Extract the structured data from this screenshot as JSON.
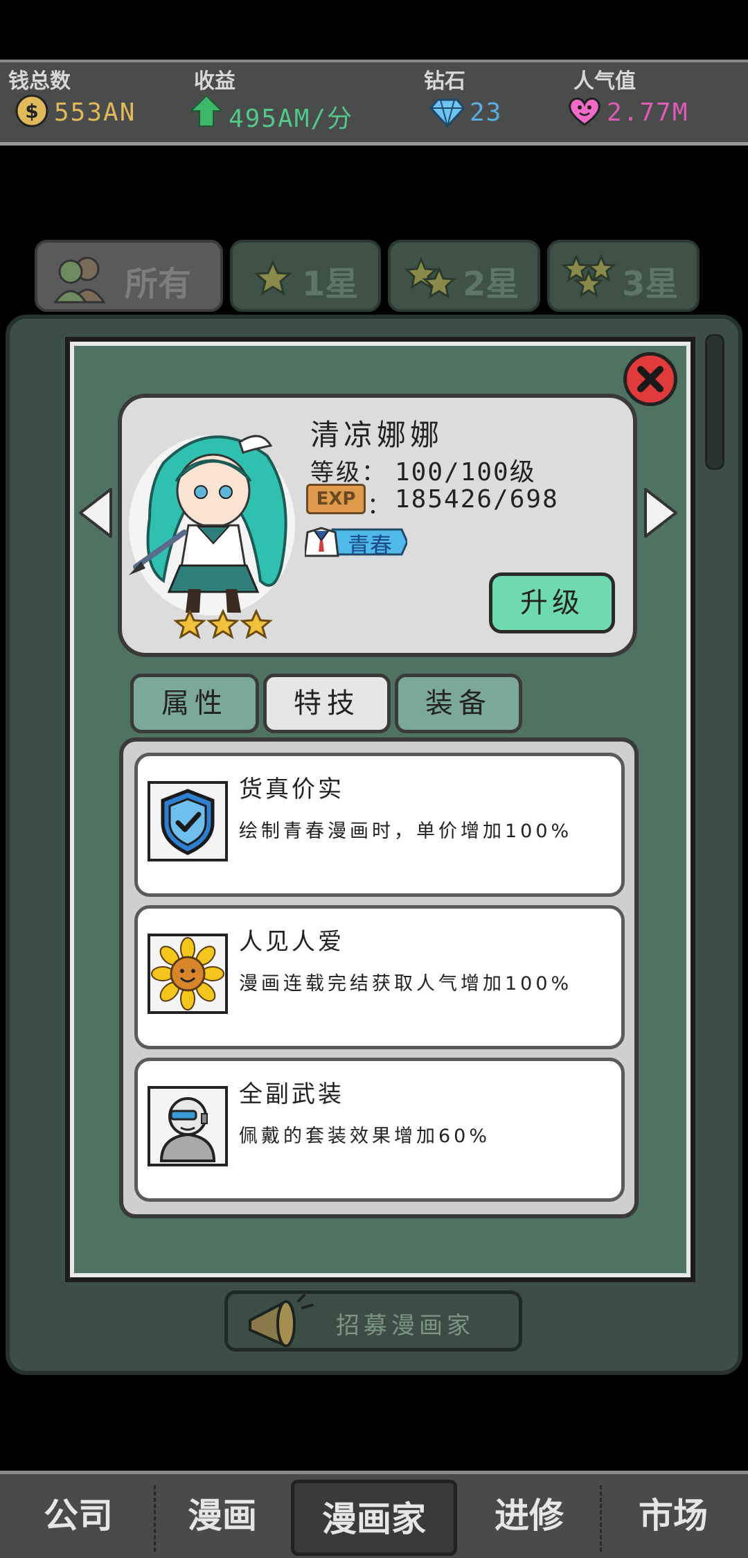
{
  "stats": [
    {
      "label": "钱总数",
      "value": "553AN",
      "icon": "coin-icon",
      "color": "#e0b95a"
    },
    {
      "label": "收益",
      "value": "495AM/分",
      "icon": "arrow-up-icon",
      "color": "#52c88a"
    },
    {
      "label": "钻石",
      "value": "23",
      "icon": "diamond-icon",
      "color": "#5aaee0"
    },
    {
      "label": "人气值",
      "value": "2.77M",
      "icon": "heart-icon",
      "color": "#e05ab8"
    }
  ],
  "filter_tabs": [
    {
      "label": "所有",
      "active": true
    },
    {
      "label": "1星"
    },
    {
      "label": "2星"
    },
    {
      "label": "3星"
    }
  ],
  "character": {
    "name": "清凉娜娜",
    "level_label": "等级：",
    "level_value": "100/100级",
    "exp_badge": "EXP",
    "exp_colon": "：",
    "exp_value": "185426/698",
    "genre": "青春",
    "stars": 3,
    "upgrade_label": "升级"
  },
  "sub_tabs": [
    {
      "label": "属性"
    },
    {
      "label": "特技",
      "active": true
    },
    {
      "label": "装备"
    }
  ],
  "skills": [
    {
      "name": "货真价实",
      "desc": "绘制青春漫画时，单价增加100%",
      "icon": "shield-check-icon"
    },
    {
      "name": "人见人爱",
      "desc": "漫画连载完结获取人气增加100%",
      "icon": "sunflower-icon"
    },
    {
      "name": "全副武装",
      "desc": "佩戴的套装效果增加60%",
      "icon": "armor-helmet-icon"
    }
  ],
  "recruit_label": "招募漫画家",
  "bottom_nav": [
    {
      "label": "公司"
    },
    {
      "label": "漫画"
    },
    {
      "label": "漫画家",
      "active": true
    },
    {
      "label": "进修"
    },
    {
      "label": "市场"
    }
  ]
}
